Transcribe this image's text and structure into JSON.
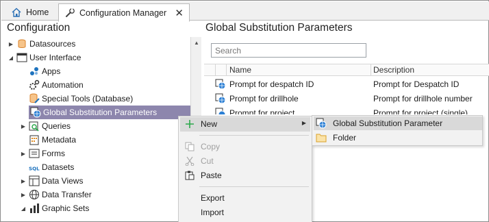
{
  "tabs": [
    {
      "label": "Home",
      "icon": "home-icon",
      "active": false
    },
    {
      "label": "Configuration Manager",
      "icon": "wrench-icon",
      "active": true,
      "close": "✕"
    }
  ],
  "left_panel": {
    "title": "Configuration",
    "tree": [
      {
        "label": "Datasources",
        "icon": "database-icon",
        "level": 0,
        "expander": "collapsed"
      },
      {
        "label": "User Interface",
        "icon": "window-icon",
        "level": 0,
        "expander": "expanded"
      },
      {
        "label": "Apps",
        "icon": "apps-icon",
        "level": 1,
        "expander": "none"
      },
      {
        "label": "Automation",
        "icon": "automation-gear-icon",
        "level": 1,
        "expander": "none"
      },
      {
        "label": "Special Tools (Database)",
        "icon": "database-tool-icon",
        "level": 1,
        "expander": "none"
      },
      {
        "label": "Global Substitution Parameters",
        "icon": "global-parameter-icon",
        "level": 1,
        "expander": "none",
        "selected": true
      },
      {
        "label": "Queries",
        "icon": "query-icon",
        "level": 1,
        "expander": "collapsed"
      },
      {
        "label": "Metadata",
        "icon": "metadata-icon",
        "level": 1,
        "expander": "none"
      },
      {
        "label": "Forms",
        "icon": "form-icon",
        "level": 1,
        "expander": "collapsed"
      },
      {
        "label": "Datasets",
        "icon": "sql-dataset-icon",
        "level": 1,
        "expander": "none"
      },
      {
        "label": "Data Views",
        "icon": "table-view-icon",
        "level": 1,
        "expander": "collapsed"
      },
      {
        "label": "Data Transfer",
        "icon": "globe-transfer-icon",
        "level": 1,
        "expander": "collapsed"
      },
      {
        "label": "Graphic Sets",
        "icon": "graphic-sets-icon",
        "level": 1,
        "expander": "expanded"
      }
    ]
  },
  "right_panel": {
    "title": "Global Substitution Parameters",
    "search_placeholder": "Search",
    "columns": [
      "Name",
      "Description"
    ],
    "rows": [
      {
        "name": "Prompt for despatch ID",
        "description": "Prompt for Despatch ID"
      },
      {
        "name": "Prompt for drillhole",
        "description": "Prompt for drillhole number"
      },
      {
        "name": "Prompt for project",
        "description": "Prompt for project (single)"
      }
    ]
  },
  "context_menu": {
    "items": [
      {
        "label": "New",
        "icon": "plus-icon",
        "enabled": true,
        "submenu": true,
        "highlighted": true
      },
      {
        "label": "Copy",
        "icon": "copy-icon",
        "enabled": false
      },
      {
        "label": "Cut",
        "icon": "scissors-icon",
        "enabled": false
      },
      {
        "label": "Paste",
        "icon": "paste-icon",
        "enabled": true
      },
      {
        "label": "Export",
        "icon": "",
        "enabled": true
      },
      {
        "label": "Import",
        "icon": "",
        "enabled": true
      }
    ]
  },
  "submenu": {
    "items": [
      {
        "label": "Global Substitution Parameter",
        "icon": "global-parameter-icon",
        "highlighted": true
      },
      {
        "label": "Folder",
        "icon": "folder-icon",
        "highlighted": false
      }
    ]
  },
  "colors": {
    "selection": "#8d86ad",
    "menu_background": "#f2f2f2",
    "menu_highlight": "#d9d9d9",
    "accent_blue": "#1e73be"
  }
}
